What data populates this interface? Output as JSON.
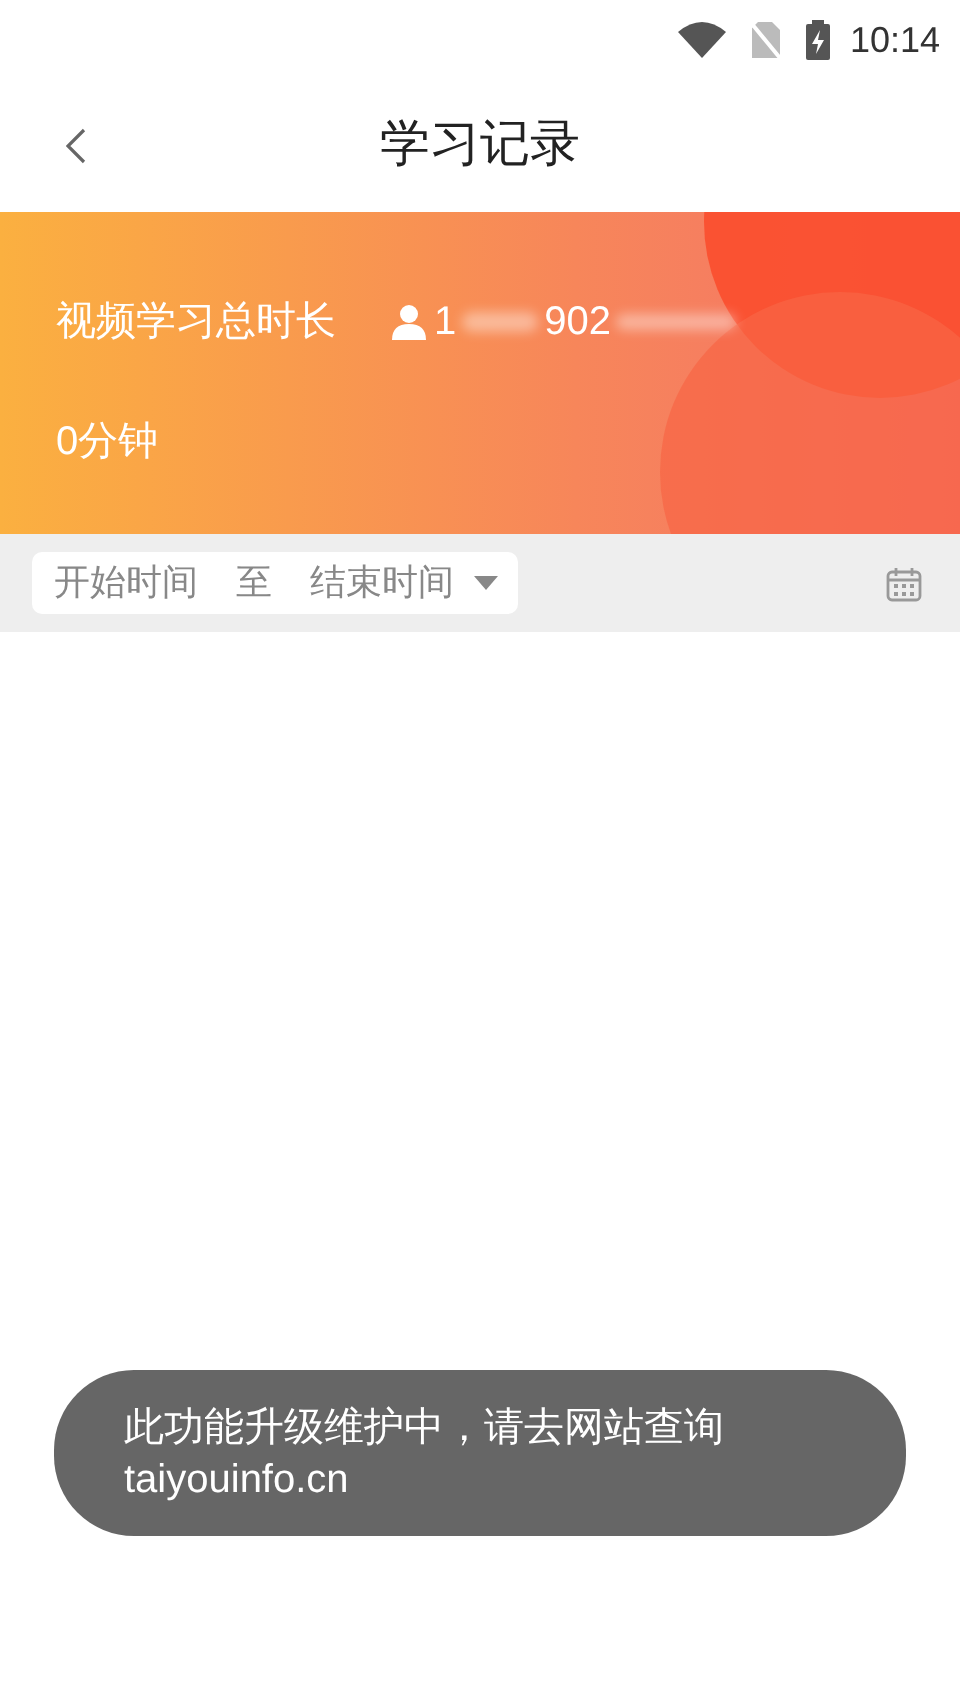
{
  "status_bar": {
    "time": "10:14"
  },
  "header": {
    "title": "学习记录"
  },
  "summary": {
    "label": "视频学习总时长",
    "user_parts": [
      "1",
      "902"
    ],
    "total": "0分钟"
  },
  "filter": {
    "start_placeholder": "开始时间",
    "separator": "至",
    "end_placeholder": "结束时间"
  },
  "toast": {
    "lines": [
      "此功能升级维护中，请去网站查询",
      "taiyouinfo.cn"
    ]
  }
}
